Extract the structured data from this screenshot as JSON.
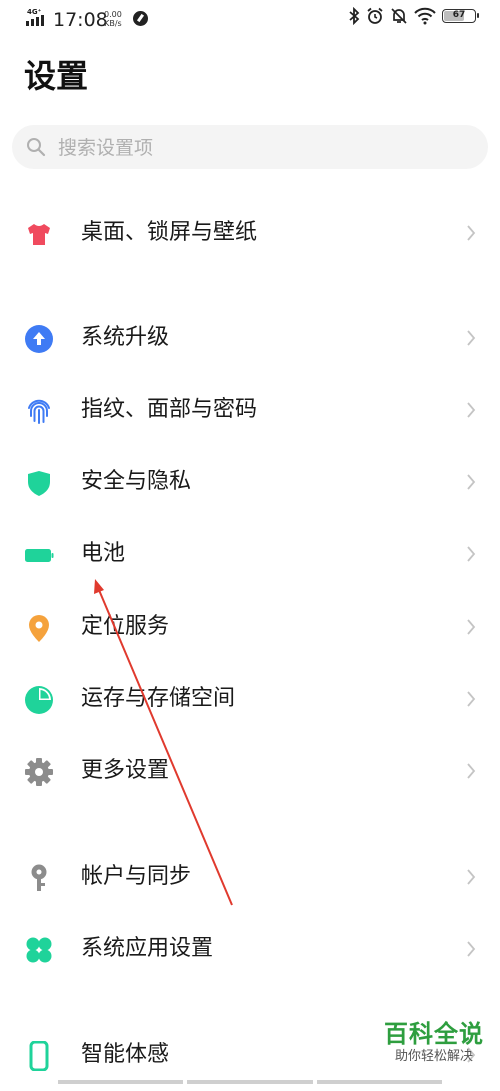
{
  "status_bar": {
    "network": "4G⁺",
    "time": "17:08",
    "speed_value": "0.00",
    "speed_unit": "KB/s",
    "battery_level": "67"
  },
  "page": {
    "title": "设置"
  },
  "search": {
    "placeholder": "搜索设置项",
    "value": ""
  },
  "items": [
    {
      "label": "桌面、锁屏与壁纸",
      "icon": "tshirt-icon",
      "color": "#f04a5e"
    },
    {
      "label": "系统升级",
      "icon": "upgrade-arrow-icon",
      "color": "#3f7bf4"
    },
    {
      "label": "指纹、面部与密码",
      "icon": "fingerprint-icon",
      "color": "#3f7bf4"
    },
    {
      "label": "安全与隐私",
      "icon": "shield-icon",
      "color": "#1fd39a"
    },
    {
      "label": "电池",
      "icon": "battery-icon",
      "color": "#1fd39a"
    },
    {
      "label": "定位服务",
      "icon": "location-pin-icon",
      "color": "#f5a23c"
    },
    {
      "label": "运存与存储空间",
      "icon": "storage-pie-icon",
      "color": "#1fd39a"
    },
    {
      "label": "更多设置",
      "icon": "gear-icon",
      "color": "#8c8c8c"
    },
    {
      "label": "帐户与同步",
      "icon": "key-icon",
      "color": "#8c8c8c"
    },
    {
      "label": "系统应用设置",
      "icon": "apps-grid-icon",
      "color": "#1fd39a"
    },
    {
      "label": "智能体感",
      "icon": "phone-motion-icon",
      "color": "#1fd39a"
    }
  ],
  "watermark": {
    "main": "百科全说",
    "sub": "助你轻松解决"
  },
  "annotation": {
    "color": "#e03a2e"
  }
}
